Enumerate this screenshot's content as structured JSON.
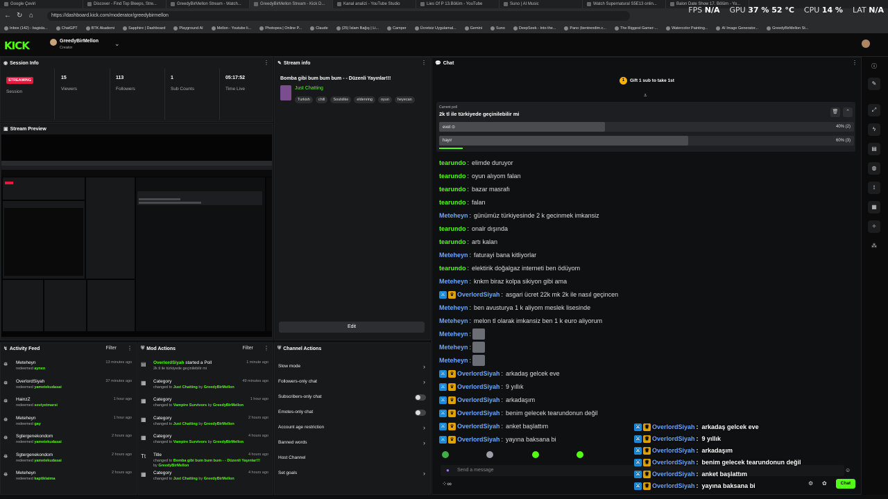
{
  "browser": {
    "tabs": [
      "Google Çeviri",
      "Discover - Find Top Bleeps, Stre...",
      "GreedyBirMellon Stream - Watch...",
      "GreedyBirMellon Stream - Kick D...",
      "Kanal analizi - YouTube Studio",
      "Lies Of P 13.Bölüm - YouTube",
      "Suno | AI Music",
      "Watch Supernatural S5E13 onlin...",
      "Balon Date Show 17. Bölüm - Yo..."
    ],
    "url": "https://dashboard.kick.com/moderator/greedybirmellon",
    "bookmarks": [
      "Inbox (142) - bagisla...",
      "ChatGPT",
      "BTK Akademi",
      "Sapphire | Dashboard",
      "Playground AI",
      "Mellon - Youtube li...",
      "Photopea | Online P...",
      "Claude",
      "(25) İslam Bağış | Li...",
      "Camper",
      "Ücretsiz Uygulamal...",
      "Gemini",
      "Suno",
      "DeepSeek - Into the...",
      "Pano (bentrendim.c...",
      "The Biggest Gamer-...",
      "Watercolor Painting...",
      "AI Image Generator...",
      "GreedyBirMellon St..."
    ]
  },
  "perf": {
    "fps_label": "FPS",
    "fps_value": "N/A",
    "gpu_label": "GPU",
    "gpu_value": "37 %  52 °C",
    "cpu_label": "CPU",
    "cpu_value": "14 %",
    "lat_label": "LAT",
    "lat_value": "N/A"
  },
  "header": {
    "logo": "KICK",
    "channel_name": "GreedyBirMellon",
    "channel_role": "Creator"
  },
  "session": {
    "title": "Session Info",
    "status": "STREAMING",
    "status_label": "Session",
    "stats": [
      {
        "value": "15",
        "label": "Viewers"
      },
      {
        "value": "113",
        "label": "Followers"
      },
      {
        "value": "1",
        "label": "Sub Counts"
      },
      {
        "value": "05:17:52",
        "label": "Time Live"
      }
    ]
  },
  "preview": {
    "title": "Stream Preview"
  },
  "stream_info": {
    "title": "Stream info",
    "stream_title": "Bomba gibi bum bum bum - - Düzenli Yayınlar!!!",
    "category": "Just Chatting",
    "tags": [
      "Turkish",
      "chill",
      "Soulslike",
      "eldenring",
      "oyun",
      "heyecan"
    ],
    "edit_label": "Edit"
  },
  "activity": {
    "title": "Activity Feed",
    "filter": "Filter",
    "items": [
      {
        "name": "Meteheyn",
        "action": "redeemed",
        "reward": "aynen",
        "time": "13 minutes ago"
      },
      {
        "name": "OverlordSiyah",
        "action": "redeemed",
        "reward": "yametekudasai",
        "time": "37 minutes ago"
      },
      {
        "name": "HainzZ",
        "action": "redeemed",
        "reward": "soviyetmarsi",
        "time": "1 hour ago"
      },
      {
        "name": "Meteheyn",
        "action": "redeemed",
        "reward": "gay",
        "time": "1 hour ago"
      },
      {
        "name": "Sgtergenekondom",
        "action": "redeemed",
        "reward": "yametekudasai",
        "time": "2 hours ago"
      },
      {
        "name": "Sgtergenekondom",
        "action": "redeemed",
        "reward": "yametekudasai",
        "time": "2 hours ago"
      },
      {
        "name": "Meteheyn",
        "action": "redeemed",
        "reward": "kapitklatma",
        "time": "2 hours ago"
      }
    ]
  },
  "mod_actions": {
    "title": "Mod Actions",
    "filter": "Filter",
    "items": [
      {
        "head_user": "OverlordSiyah",
        "head_text": "started a Poll",
        "sub": "2k tl ile türkiyede geçinilebilir mi",
        "time": "1 minute ago"
      },
      {
        "head_user": "",
        "head_text": "Category",
        "sub_pre": "changed to ",
        "sub_cat": "Just Chatting",
        "sub_by": " by ",
        "sub_user": "GreedyBirMellon",
        "time": "49 minutes ago"
      },
      {
        "head_user": "",
        "head_text": "Category",
        "sub_pre": "changed to ",
        "sub_cat": "Vampire Survivors",
        "sub_by": " by ",
        "sub_user": "GreedyBirMellon",
        "time": "1 hour ago"
      },
      {
        "head_user": "",
        "head_text": "Category",
        "sub_pre": "changed to ",
        "sub_cat": "Just Chatting",
        "sub_by": " by ",
        "sub_user": "GreedyBirMellon",
        "time": "2 hours ago"
      },
      {
        "head_user": "",
        "head_text": "Category",
        "sub_pre": "changed to ",
        "sub_cat": "Vampire Survivors",
        "sub_by": " by ",
        "sub_user": "GreedyBirMellon",
        "time": "4 hours ago"
      },
      {
        "head_user": "",
        "head_text": "Title",
        "sub_pre": "changed to ",
        "sub_cat": "Bomba gibi bum bum bum - - Düzenli Yayınlar!!!",
        "sub_by": " by ",
        "sub_user": "GreedyBirMellon",
        "time": "4 hours ago"
      },
      {
        "head_user": "",
        "head_text": "Category",
        "sub_pre": "changed to ",
        "sub_cat": "Just Chatting",
        "sub_by": " by ",
        "sub_user": "GreedyBirMellon",
        "time": "4 hours ago"
      }
    ]
  },
  "channel_actions": {
    "title": "Channel Actions",
    "items": [
      {
        "label": "Slow mode",
        "control": "chevron"
      },
      {
        "label": "Followers-only chat",
        "control": "chevron"
      },
      {
        "label": "Subscribers-only chat",
        "control": "toggle"
      },
      {
        "label": "Emotes-only chat",
        "control": "toggle"
      },
      {
        "label": "Account age restriction",
        "control": "chevron"
      },
      {
        "label": "Banned words",
        "control": "chevron"
      },
      {
        "label": "Host Channel",
        "control": "none"
      },
      {
        "label": "Set goals",
        "control": "chevron"
      }
    ]
  },
  "chat": {
    "title": "Chat",
    "gift_badge": "1",
    "gift_text": "Gift 1 sub to take 1st",
    "poll": {
      "caption": "Current poll",
      "question": "2k tl ile türkiyede geçinilebilir mi",
      "options": [
        {
          "label": "evet",
          "pct_text": "40% (2)",
          "pct": 40
        },
        {
          "label": "hayır",
          "pct_text": "60% (3)",
          "pct": 60
        }
      ]
    },
    "messages": [
      {
        "user": "tearundo",
        "text": "elimde duruyor",
        "color": "g",
        "badges": [],
        "emote": false
      },
      {
        "user": "tearundo",
        "text": "oyun alıyom falan",
        "color": "g",
        "badges": [],
        "emote": false
      },
      {
        "user": "tearundo",
        "text": "bazar masrafı",
        "color": "g",
        "badges": [],
        "emote": false
      },
      {
        "user": "tearundo",
        "text": "falan",
        "color": "g",
        "badges": [],
        "emote": false
      },
      {
        "user": "Meteheyn",
        "text": "günümüz türkiyesinde 2 k gecinmek imkansiz",
        "color": "b",
        "badges": [],
        "emote": false
      },
      {
        "user": "tearundo",
        "text": "onalr dışında",
        "color": "g",
        "badges": [],
        "emote": false
      },
      {
        "user": "tearundo",
        "text": "artı kalan",
        "color": "g",
        "badges": [],
        "emote": false
      },
      {
        "user": "Meteheyn",
        "text": "faturayi bana kitliyorlar",
        "color": "b",
        "badges": [],
        "emote": false
      },
      {
        "user": "tearundo",
        "text": "elektirik doğalgaz interneti ben ödüyom",
        "color": "g",
        "badges": [],
        "emote": false
      },
      {
        "user": "Meteheyn",
        "text": "knkm biraz kolpa sikiyon gibi ama",
        "color": "b",
        "badges": [],
        "emote": false
      },
      {
        "user": "OverlordSiyah",
        "text": "asgari ücret 22k mk 2k ile nasıl geçincen",
        "color": "b",
        "badges": [
          "mod",
          "crown"
        ],
        "emote": false
      },
      {
        "user": "Meteheyn",
        "text": "ben avusturya 1 k aliyom meslek lisesinde",
        "color": "b",
        "badges": [],
        "emote": false
      },
      {
        "user": "Meteheyn",
        "text": "melon tl olarak imkansiz ben 1 k euro aliyorum",
        "color": "b",
        "badges": [],
        "emote": false
      },
      {
        "user": "Meteheyn",
        "text": "",
        "color": "b",
        "badges": [],
        "emote": true
      },
      {
        "user": "Meteheyn",
        "text": "",
        "color": "b",
        "badges": [],
        "emote": true
      },
      {
        "user": "Meteheyn",
        "text": "",
        "color": "b",
        "badges": [],
        "emote": true
      },
      {
        "user": "OverlordSiyah",
        "text": "arkadaş gelcek eve",
        "color": "b",
        "badges": [
          "mod",
          "crown"
        ],
        "emote": false
      },
      {
        "user": "OverlordSiyah",
        "text": "9 yıllık",
        "color": "b",
        "badges": [
          "mod",
          "crown"
        ],
        "emote": false
      },
      {
        "user": "OverlordSiyah",
        "text": "arkadaşım",
        "color": "b",
        "badges": [
          "mod",
          "crown"
        ],
        "emote": false
      },
      {
        "user": "OverlordSiyah",
        "text": "benim gelecek tearundonun değil",
        "color": "b",
        "badges": [
          "mod",
          "crown"
        ],
        "emote": false
      },
      {
        "user": "OverlordSiyah",
        "text": "anket başlattım",
        "color": "b",
        "badges": [
          "mod",
          "crown"
        ],
        "emote": false
      },
      {
        "user": "OverlordSiyah",
        "text": "yayına baksana bi",
        "color": "b",
        "badges": [
          "mod",
          "crown"
        ],
        "emote": false
      }
    ],
    "send_placeholder": "Send a message",
    "chat_button": "Chat",
    "bottom_icon_text": "∞"
  },
  "overlay_chat": [
    {
      "user": "OverlordSiyah",
      "text": "arkadaş gelcek eve"
    },
    {
      "user": "OverlordSiyah",
      "text": "9 yıllık"
    },
    {
      "user": "OverlordSiyah",
      "text": "arkadaşım"
    },
    {
      "user": "OverlordSiyah",
      "text": "benim gelecek tearundonun değil"
    },
    {
      "user": "OverlordSiyah",
      "text": "anket başlattım"
    },
    {
      "user": "OverlordSiyah",
      "text": "yayına baksana bi"
    }
  ],
  "colors": {
    "accent": "#53fc18",
    "live": "#e8173e",
    "user_blue": "#6aa8ff",
    "crown": "#e2a300",
    "mod": "#1c8ad6"
  }
}
